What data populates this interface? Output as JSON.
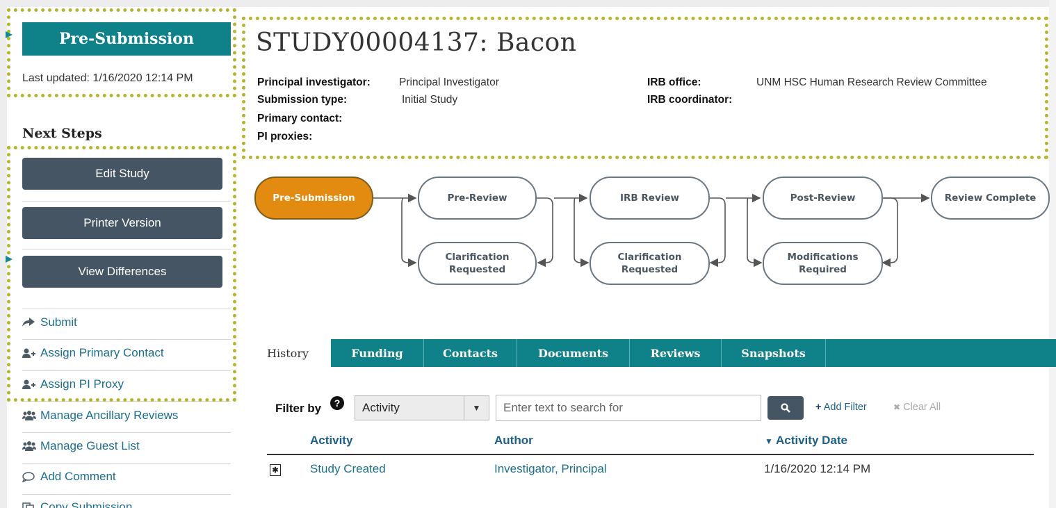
{
  "sidebar": {
    "state_label": "Pre-Submission",
    "last_updated": "Last updated: 1/16/2020 12:14 PM",
    "next_steps_heading": "Next Steps",
    "buttons": [
      {
        "label": "Edit Study"
      },
      {
        "label": "Printer Version"
      },
      {
        "label": "View Differences"
      }
    ],
    "actions": [
      {
        "label": "Submit",
        "icon": "share-arrow-icon"
      },
      {
        "label": "Assign Primary Contact",
        "icon": "user-add-icon"
      },
      {
        "label": "Assign PI Proxy",
        "icon": "user-add-icon"
      },
      {
        "label": "Manage Ancillary Reviews",
        "icon": "users-icon"
      },
      {
        "label": "Manage Guest List",
        "icon": "users-icon"
      },
      {
        "label": "Add Comment",
        "icon": "comment-icon"
      },
      {
        "label": "Copy Submission",
        "icon": "copy-icon"
      }
    ]
  },
  "header": {
    "title": "STUDY00004137: Bacon",
    "fields": {
      "pi_label": "Principal investigator:",
      "pi_value": "Principal Investigator",
      "submission_type_label": "Submission type:",
      "submission_type_value": "Initial Study",
      "primary_contact_label": "Primary contact:",
      "pi_proxies_label": "PI proxies:",
      "irb_office_label": "IRB office:",
      "irb_office_value": "UNM HSC Human Research Review Committee",
      "irb_coordinator_label": "IRB coordinator:"
    }
  },
  "workflow": {
    "stages": [
      {
        "label": "Pre-Submission",
        "active": true
      },
      {
        "label": "Pre-Review"
      },
      {
        "label": "IRB Review"
      },
      {
        "label": "Post-Review"
      },
      {
        "label": "Review Complete"
      }
    ],
    "loops": [
      {
        "line1": "Clarification",
        "line2": "Requested"
      },
      {
        "line1": "Clarification",
        "line2": "Requested"
      },
      {
        "line1": "Modifications",
        "line2": "Required"
      }
    ]
  },
  "tabs": [
    {
      "label": "History",
      "active": true
    },
    {
      "label": "Funding"
    },
    {
      "label": "Contacts"
    },
    {
      "label": "Documents"
    },
    {
      "label": "Reviews"
    },
    {
      "label": "Snapshots"
    }
  ],
  "filter": {
    "label": "Filter by",
    "help_glyph": "?",
    "select_value": "Activity",
    "search_placeholder": "Enter text to search for",
    "add_filter": "Add Filter",
    "clear_all": "Clear All"
  },
  "history_table": {
    "columns": [
      "Activity",
      "Author",
      "Activity Date"
    ],
    "rows": [
      {
        "activity": "Study Created",
        "author": "Investigator, Principal",
        "date": "1/16/2020 12:14 PM"
      }
    ]
  },
  "colors": {
    "brand_teal": "#0e8189",
    "button_slate": "#455563",
    "active_stage": "#e38b10",
    "highlight": "#b5b52a",
    "link": "#1a6f8e"
  }
}
